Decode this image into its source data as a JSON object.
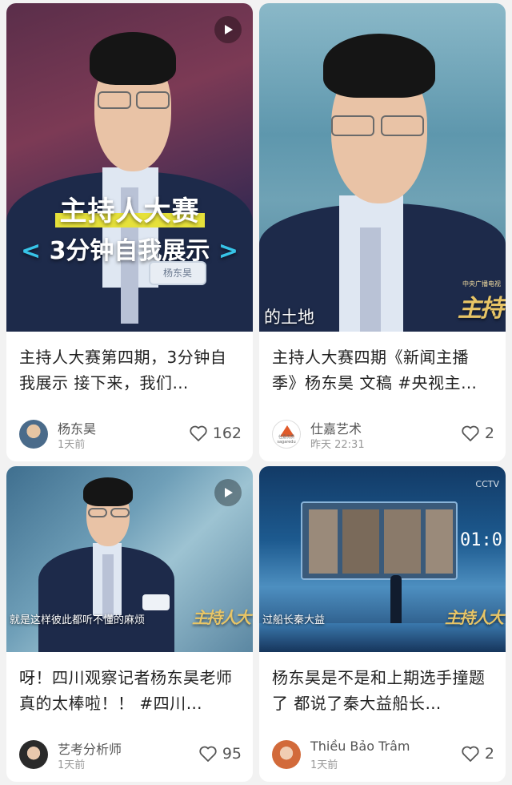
{
  "cards": [
    {
      "overlay_title": "主持人大赛",
      "overlay_sub_left": "<",
      "overlay_sub_text": "3分钟自我展示",
      "overlay_sub_right": ">",
      "nametag": "杨东昊",
      "caption": "主持人大赛第四期，3分钟自我展示 接下来，我们…",
      "author": "杨东昊",
      "time": "1天前",
      "likes": "162",
      "has_play": true
    },
    {
      "subtitle": "的土地",
      "logo": "主持",
      "logo_small": "中央广播电视",
      "caption": "主持人大赛四期《新闻主播季》杨东昊 文稿 #央视主…",
      "author": "仕嘉艺术",
      "time": "昨天 22:31",
      "likes": "2",
      "avatar_text": "仕嘉优质 sagaredu"
    },
    {
      "subtitle": "就是这样彼此都听不懂的麻烦",
      "logo": "主持人大",
      "caption": "呀！四川观察记者杨东昊老师真的太棒啦！！ #四川…",
      "author": "艺考分析师",
      "time": "1天前",
      "likes": "95",
      "has_play": true
    },
    {
      "subtitle": "过船长秦大益",
      "logo": "主持人大",
      "timer": "01:0",
      "cctv": "CCTV",
      "caption": "杨东昊是不是和上期选手撞题了 都说了秦大益船长…",
      "author": "Thiều Bảo Trâm",
      "time": "1天前",
      "likes": "2"
    }
  ],
  "icons": {
    "play": "play-icon",
    "like": "heart-outline-icon"
  }
}
